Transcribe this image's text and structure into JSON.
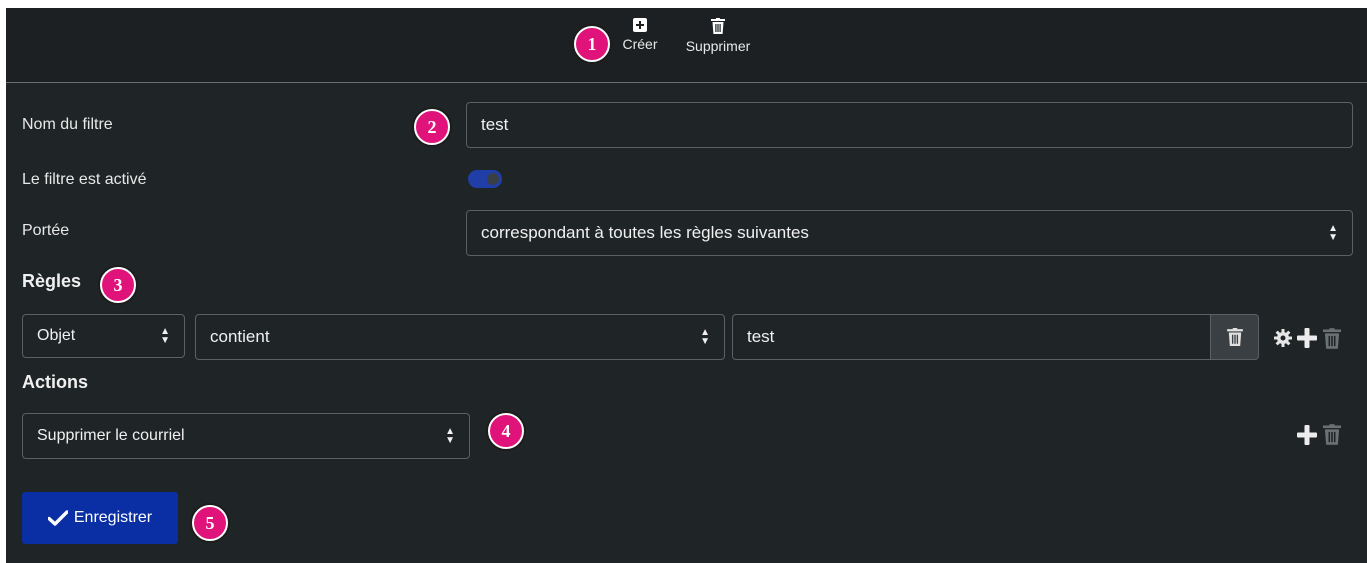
{
  "toolbar": {
    "create_label": "Créer",
    "delete_label": "Supprimer"
  },
  "form": {
    "name_label": "Nom du filtre",
    "name_value": "test",
    "active_label": "Le filtre est activé",
    "active": true,
    "scope_label": "Portée",
    "scope_value": "correspondant à toutes les règles suivantes"
  },
  "rules": {
    "heading": "Règles",
    "items": [
      {
        "field": "Objet",
        "operator": "contient",
        "value": "test"
      }
    ]
  },
  "actions": {
    "heading": "Actions",
    "items": [
      {
        "action": "Supprimer le courriel"
      }
    ]
  },
  "save_label": "Enregistrer",
  "badges": [
    "1",
    "2",
    "3",
    "4",
    "5"
  ],
  "colors": {
    "background": "#1f2426",
    "accent": "#0a2fa5",
    "badge": "#e0137a",
    "toggle_on": "#1f3ea8"
  }
}
